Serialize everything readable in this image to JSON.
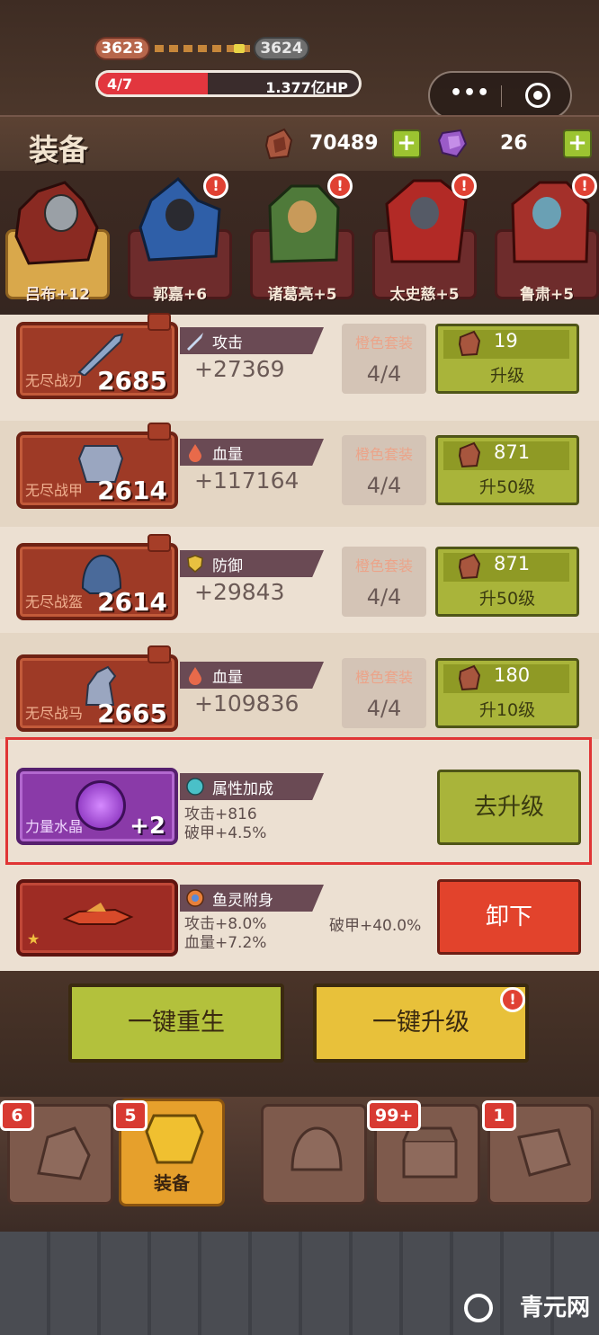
{
  "stage": {
    "current": "3623",
    "next": "3624",
    "progress": "4/7",
    "progress_fraction": 0.42,
    "boss_hp": "1.377亿HP"
  },
  "capsule": {
    "more": "•••"
  },
  "header": {
    "title": "装备",
    "coins": "70489",
    "gems": "26"
  },
  "heroes": [
    {
      "name": "吕布+12",
      "selected": true,
      "alert": false
    },
    {
      "name": "郭嘉+6",
      "selected": false,
      "alert": true
    },
    {
      "name": "诸葛亮+5",
      "selected": false,
      "alert": true
    },
    {
      "name": "太史慈+5",
      "selected": false,
      "alert": true
    },
    {
      "name": "鲁肃+5",
      "selected": false,
      "alert": true
    }
  ],
  "equipment": [
    {
      "name": "无尽战刃",
      "level": "2685",
      "stat": "攻击",
      "value": "+27369",
      "set_label": "橙色套装",
      "set_value": "4/4",
      "cost": "19",
      "action": "升级"
    },
    {
      "name": "无尽战甲",
      "level": "2614",
      "stat": "血量",
      "value": "+117164",
      "set_label": "橙色套装",
      "set_value": "4/4",
      "cost": "871",
      "action": "升50级"
    },
    {
      "name": "无尽战盔",
      "level": "2614",
      "stat": "防御",
      "value": "+29843",
      "set_label": "橙色套装",
      "set_value": "4/4",
      "cost": "871",
      "action": "升50级"
    },
    {
      "name": "无尽战马",
      "level": "2665",
      "stat": "血量",
      "value": "+109836",
      "set_label": "橙色套装",
      "set_value": "4/4",
      "cost": "180",
      "action": "升10级"
    }
  ],
  "crystal": {
    "name": "力量水晶",
    "level": "+2",
    "tag": "属性加成",
    "line1": "攻击+816",
    "line2": "破甲+4.5%",
    "action": "去升级"
  },
  "spirit": {
    "tag": "鱼灵附身",
    "line1": "攻击+8.0%",
    "line2": "血量+7.2%",
    "extra": "破甲+40.0%",
    "action": "卸下"
  },
  "buttons": {
    "rebirth": "一键重生",
    "upgrade": "一键升级"
  },
  "tabs": [
    {
      "label": "",
      "badge": "6"
    },
    {
      "label": "装备",
      "badge": "5"
    },
    {
      "label": "",
      "badge": ""
    },
    {
      "label": "",
      "badge": "99+"
    },
    {
      "label": "",
      "badge": "1"
    }
  ],
  "watermark": "青元网"
}
